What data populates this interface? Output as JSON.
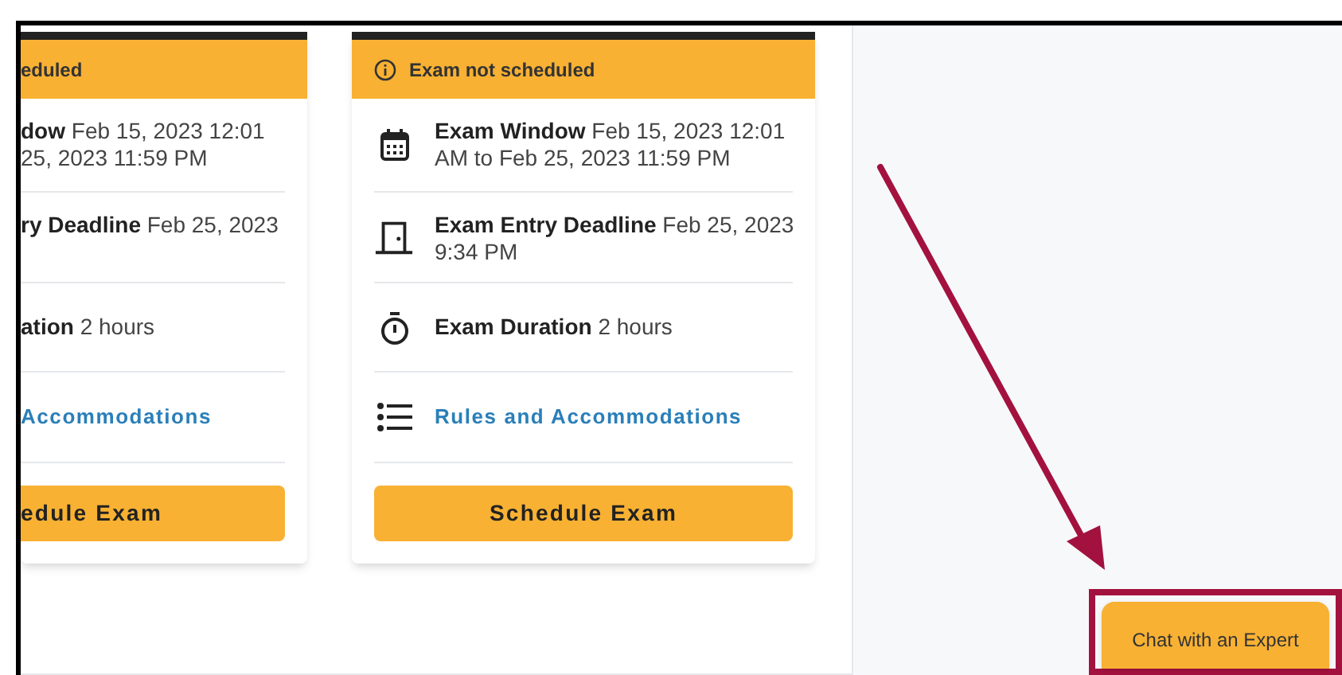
{
  "cards": [
    {
      "cut": true,
      "status": "eduled",
      "rows": [
        {
          "kind": "window",
          "lines": [
            "**dow** Feb 15, 2023 12:01",
            "25, 2023 11:59 PM"
          ]
        },
        {
          "kind": "deadline",
          "lines": [
            "**ry Deadline** Feb 25, 2023"
          ]
        },
        {
          "kind": "duration",
          "lines": [
            "**ation** 2 hours"
          ]
        },
        {
          "kind": "rules",
          "lines": [
            "Accommodations"
          ]
        }
      ],
      "button": "edule Exam"
    },
    {
      "cut": false,
      "status": "Exam not scheduled",
      "rows": [
        {
          "kind": "window",
          "lines": [
            "**Exam Window** Feb 15, 2023 12:01",
            "AM to Feb 25, 2023 11:59 PM"
          ]
        },
        {
          "kind": "deadline",
          "lines": [
            "**Exam Entry Deadline** Feb 25, 2023",
            "9:34 PM"
          ]
        },
        {
          "kind": "duration",
          "lines": [
            "**Exam Duration** 2 hours"
          ]
        },
        {
          "kind": "rules",
          "lines": [
            "Rules and Accommodations"
          ]
        }
      ],
      "button": "Schedule Exam"
    }
  ],
  "chat_button": "Chat with an Expert"
}
